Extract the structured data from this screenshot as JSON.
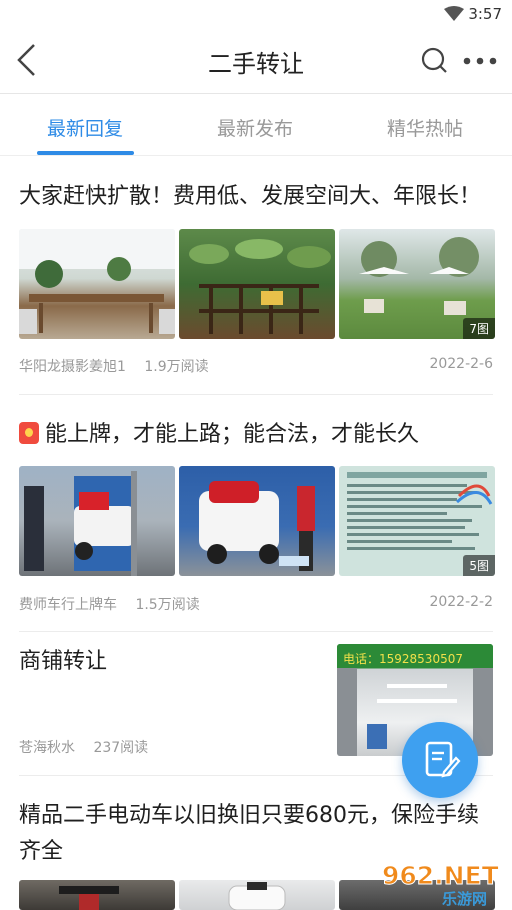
{
  "status": {
    "time": "3:57"
  },
  "nav": {
    "title": "二手转让"
  },
  "tabs": [
    {
      "label": "最新回复",
      "active": true
    },
    {
      "label": "最新发布",
      "active": false
    },
    {
      "label": "精华热帖",
      "active": false
    }
  ],
  "posts": [
    {
      "title": "大家赶快扩散！费用低、发展空间大、年限长！",
      "image_count": "7图",
      "author": "华阳龙摄影姜旭1",
      "reads": "1.9万阅读",
      "date": "2022-2-6"
    },
    {
      "title": "能上牌，才能上路；能合法，才能长久",
      "image_count": "5图",
      "author": "费师车行上牌车",
      "reads": "1.5万阅读",
      "date": "2022-2-2"
    },
    {
      "title": "商铺转让",
      "author": "苍海秋水",
      "reads": "237阅读",
      "shop_sign": "电话：15928530507"
    },
    {
      "title": "精品二手电动车以旧换旧只要680元，保险手续齐全"
    }
  ],
  "watermark": {
    "text": "962.NET",
    "subtext": "乐游网"
  },
  "colors": {
    "accent": "#2e8be6",
    "fab": "#3ea0f0"
  }
}
